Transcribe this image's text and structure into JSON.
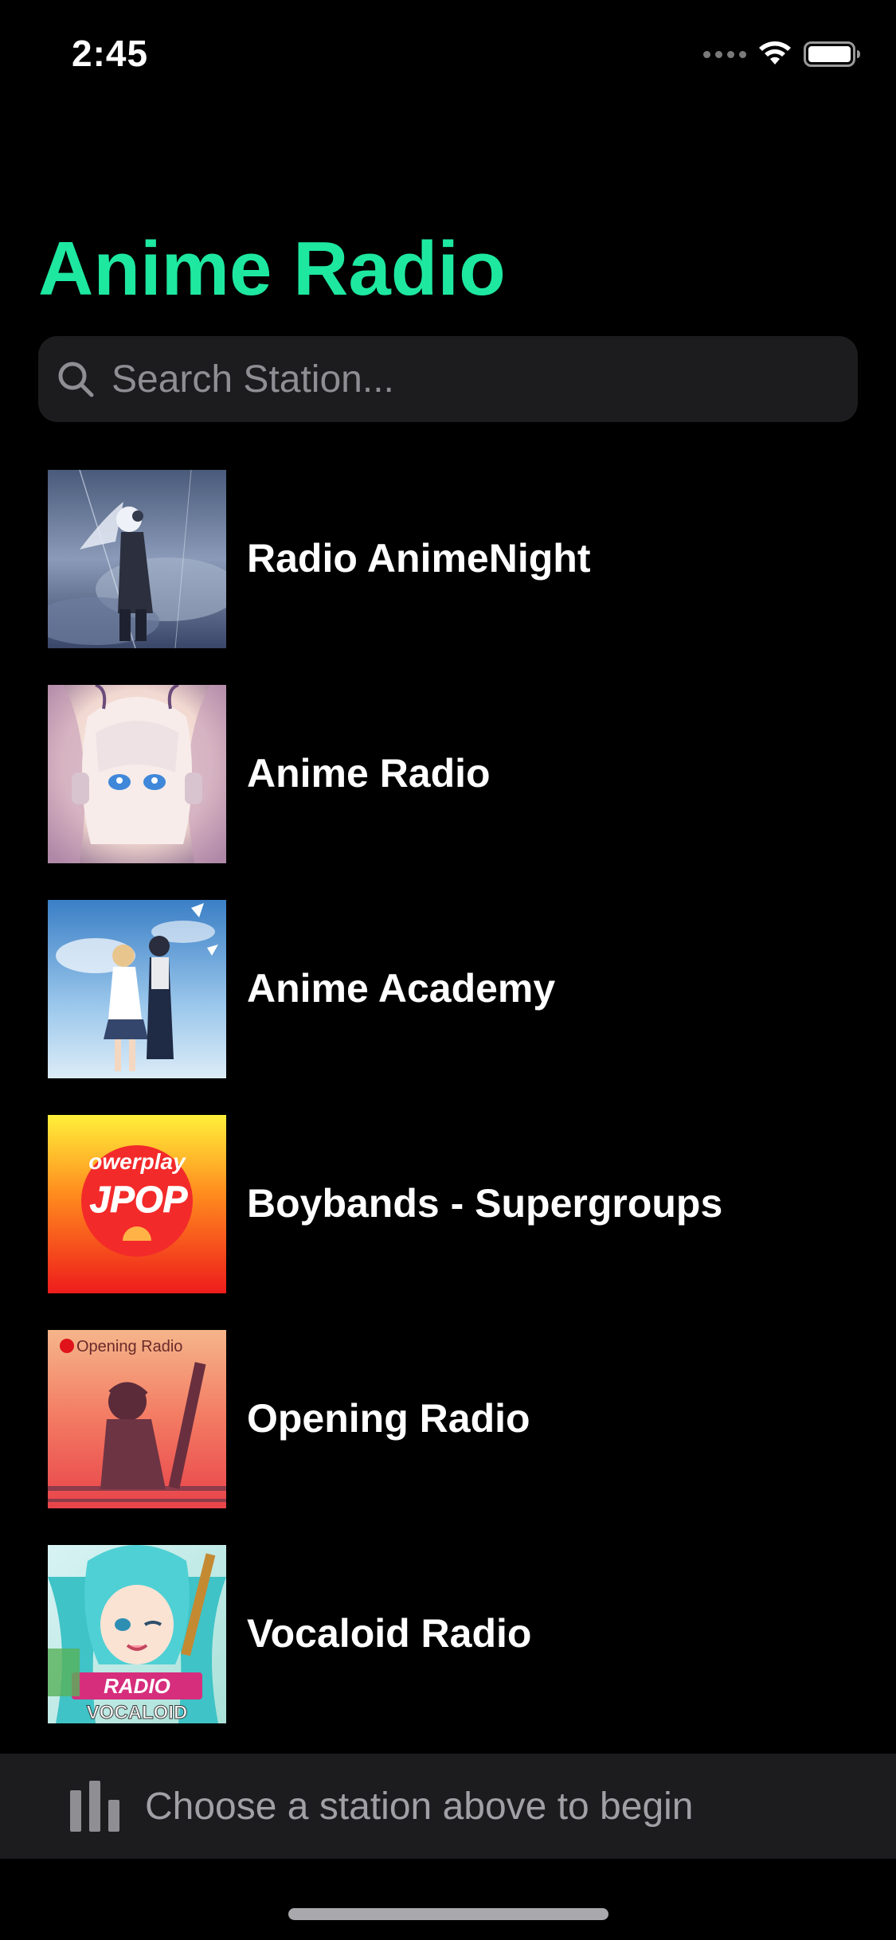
{
  "status_bar": {
    "time": "2:45"
  },
  "header": {
    "title": "Anime Radio",
    "title_color": "#1ee8a0"
  },
  "search": {
    "placeholder": "Search Station...",
    "value": ""
  },
  "stations": [
    {
      "name": "Radio AnimeNight",
      "artwork": "anime-girl-headphones-stormy-sky"
    },
    {
      "name": "Anime Radio",
      "artwork": "anime-girl-blue-eyes-headphones"
    },
    {
      "name": "Anime Academy",
      "artwork": "anime-couple-blue-sky"
    },
    {
      "name": "Boybands - Supergroups",
      "artwork": "powerplay-jpop-logo",
      "artwork_text": "owerplay",
      "artwork_logo": "JPOP"
    },
    {
      "name": "Opening Radio",
      "artwork": "opening-radio-sunset-girl",
      "artwork_text": "Opening Radio"
    },
    {
      "name": "Vocaloid Radio",
      "artwork": "vocaloid-miku",
      "artwork_text": "RADIO",
      "artwork_subtext": "VOCALOID"
    }
  ],
  "player": {
    "message": "Choose a station above to begin",
    "icon": "bars-icon"
  }
}
